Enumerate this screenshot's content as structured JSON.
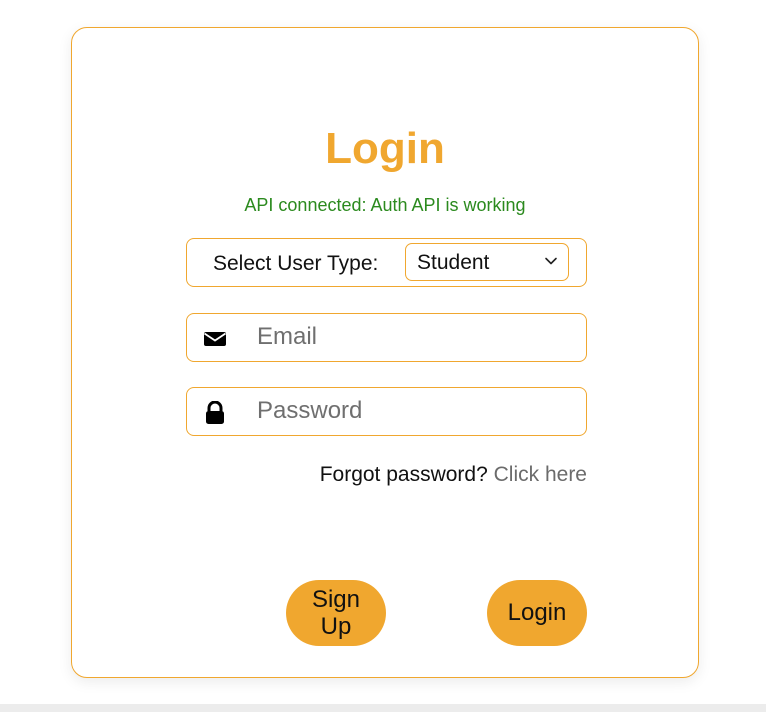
{
  "login": {
    "title": "Login",
    "status": "API connected: Auth API is working",
    "user_type": {
      "label": "Select User Type:",
      "selected": "Student"
    },
    "email": {
      "placeholder": "Email"
    },
    "password": {
      "placeholder": "Password"
    },
    "forgot": {
      "text": "Forgot password?",
      "link": "Click here"
    },
    "buttons": {
      "signup": "Sign Up",
      "login": "Login"
    }
  },
  "colors": {
    "accent": "#f0a72f",
    "status": "#2b8a1e",
    "link": "#6b6b6b"
  },
  "icons": {
    "email": "envelope-icon",
    "password": "lock-icon",
    "select": "chevron-down-icon"
  }
}
